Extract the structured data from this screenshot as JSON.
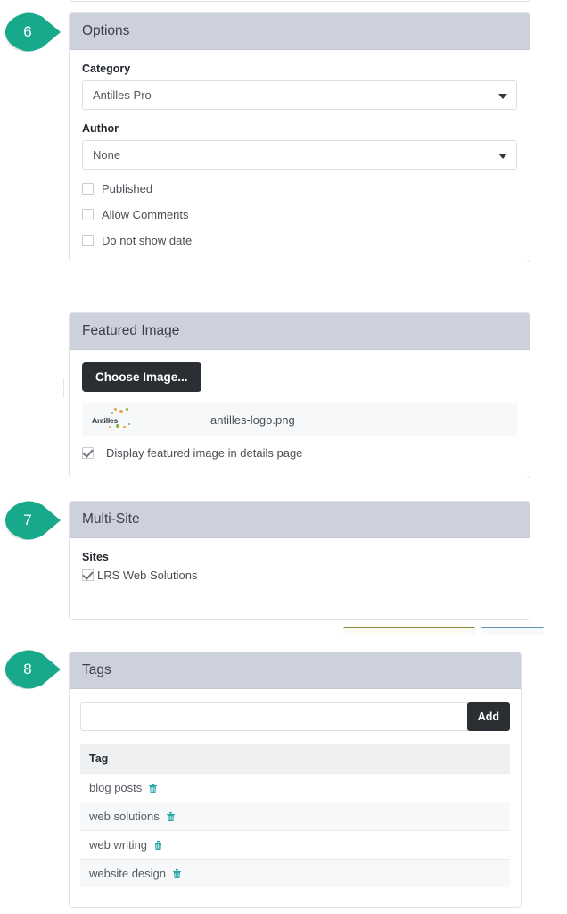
{
  "colors": {
    "callout": "#18a88a",
    "panel_header": "#ccd1dc",
    "dark_button": "#2b2f33",
    "trash_icon": "#2aa8a8",
    "stub_button_olive": "#8a8530",
    "stub_button_blue": "#5b8fb5"
  },
  "callouts": [
    {
      "number": "6",
      "target": "options-panel"
    },
    {
      "number": "7",
      "target": "multi-site-panel"
    },
    {
      "number": "8",
      "target": "tags-panel"
    }
  ],
  "options": {
    "title": "Options",
    "category": {
      "label": "Category",
      "value": "Antilles Pro",
      "icon": "chevron-down-icon"
    },
    "author": {
      "label": "Author",
      "value": "None",
      "icon": "chevron-down-icon"
    },
    "checkboxes": [
      {
        "label": "Published",
        "checked": false
      },
      {
        "label": "Allow Comments",
        "checked": false
      },
      {
        "label": "Do not show date",
        "checked": false
      }
    ]
  },
  "featured_image": {
    "title": "Featured Image",
    "choose_button": "Choose Image...",
    "file": {
      "thumbnail_alt": "Antilles",
      "name": "antilles-logo.png"
    },
    "display_checkbox": {
      "label": "Display featured image in details page",
      "checked": true
    }
  },
  "multi_site": {
    "title": "Multi-Site",
    "sites_label": "Sites",
    "sites": [
      {
        "label": "LRS Web Solutions",
        "checked": true
      }
    ]
  },
  "tags": {
    "title": "Tags",
    "input_value": "",
    "input_placeholder": "",
    "add_button": "Add",
    "column_header": "Tag",
    "items": [
      {
        "label": "blog posts",
        "delete_icon": "trash-icon"
      },
      {
        "label": "web solutions",
        "delete_icon": "trash-icon"
      },
      {
        "label": "web writing",
        "delete_icon": "trash-icon"
      },
      {
        "label": "website design",
        "delete_icon": "trash-icon"
      }
    ]
  }
}
